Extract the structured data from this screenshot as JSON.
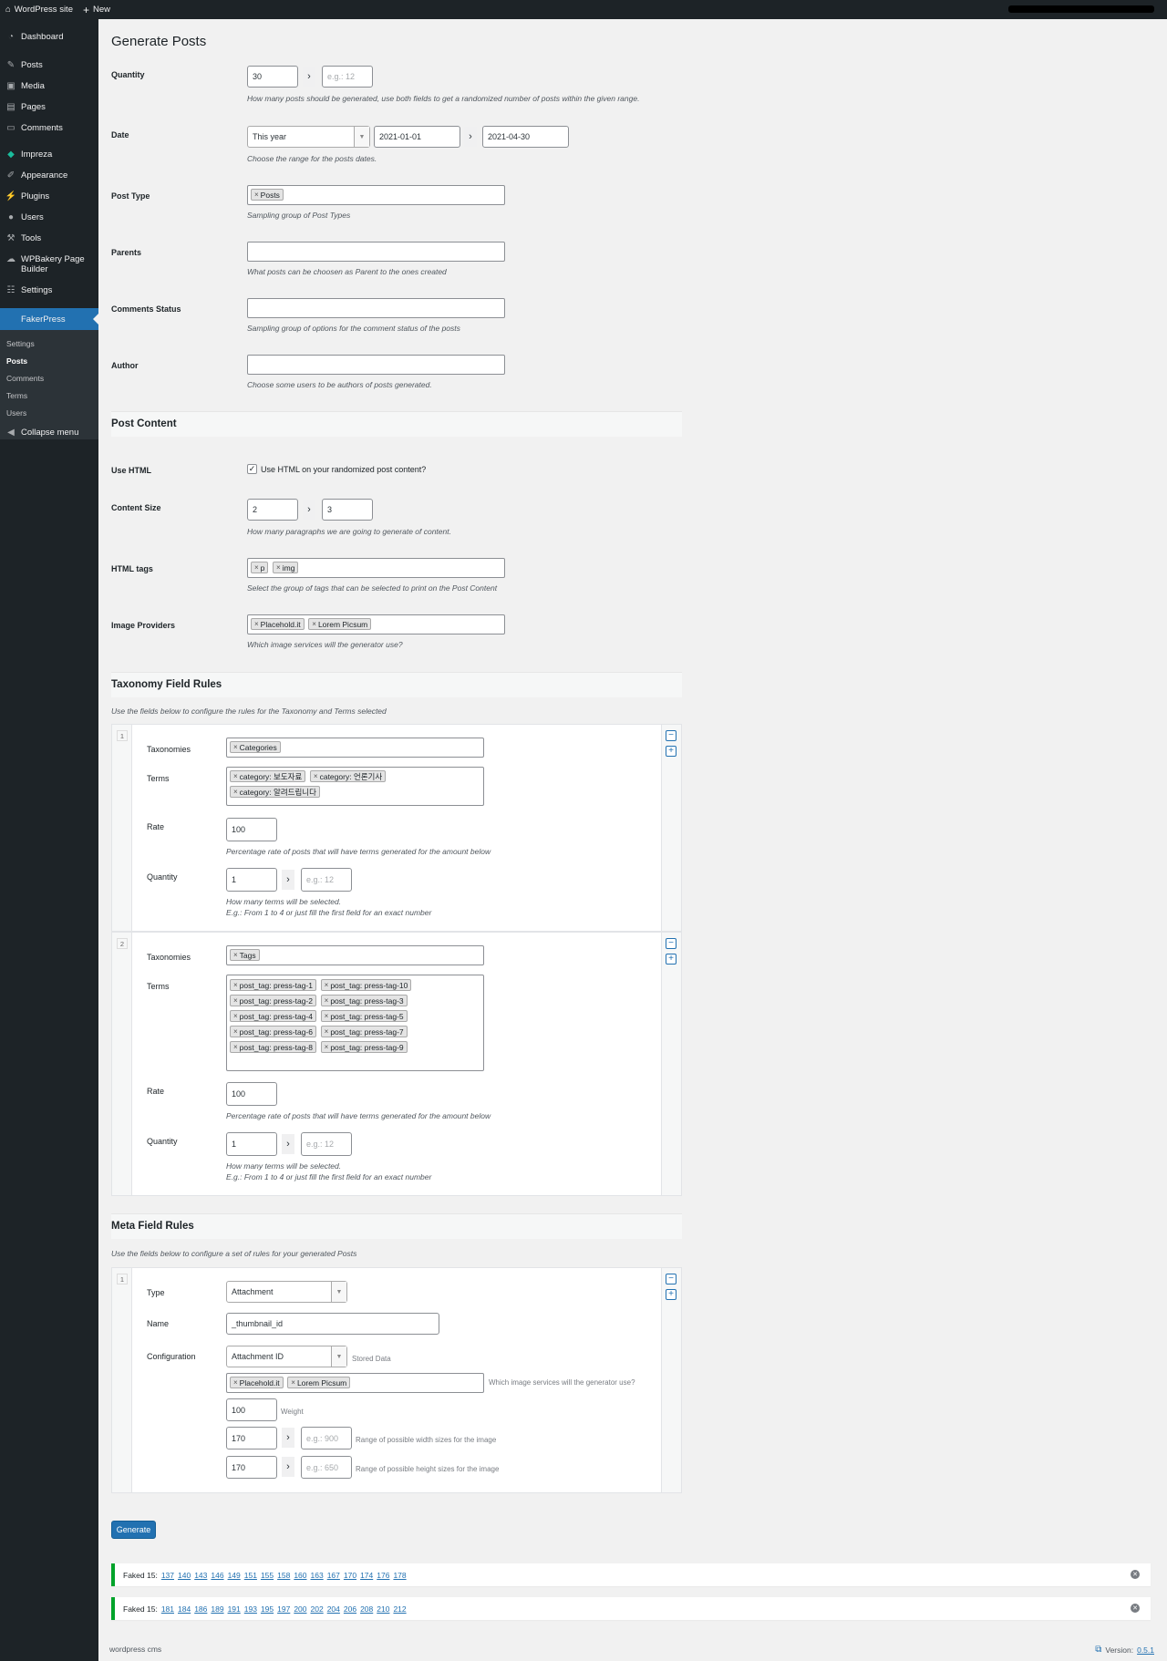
{
  "adminbar": {
    "site_name": "WordPress site",
    "new_label": "New"
  },
  "sidebar": {
    "items": [
      {
        "label": "Dashboard",
        "icon": "dashboard-icon"
      },
      {
        "label": "Posts",
        "icon": "pin-icon"
      },
      {
        "label": "Media",
        "icon": "media-icon"
      },
      {
        "label": "Pages",
        "icon": "pages-icon"
      },
      {
        "label": "Comments",
        "icon": "comments-icon"
      },
      {
        "label": "Impreza",
        "icon": "impreza-icon"
      },
      {
        "label": "Appearance",
        "icon": "brush-icon"
      },
      {
        "label": "Plugins",
        "icon": "plug-icon"
      },
      {
        "label": "Users",
        "icon": "user-icon"
      },
      {
        "label": "Tools",
        "icon": "wrench-icon"
      },
      {
        "label": "WPBakery Page Builder",
        "icon": "wpbakery-icon"
      },
      {
        "label": "Settings",
        "icon": "settings-icon"
      },
      {
        "label": "FakerPress",
        "icon": "fakerpress-icon"
      }
    ],
    "submenu": [
      "Settings",
      "Posts",
      "Comments",
      "Terms",
      "Users"
    ],
    "collapse_label": "Collapse menu"
  },
  "page": {
    "title": "Generate Posts"
  },
  "fields": {
    "quantity": {
      "label": "Quantity",
      "min": "30",
      "max_placeholder": "e.g.: 12",
      "desc": "How many posts should be generated, use both fields to get a randomized number of posts within the given range."
    },
    "date": {
      "label": "Date",
      "preset": "This year",
      "from": "2021-01-01",
      "to": "2021-04-30",
      "desc": "Choose the range for the posts dates."
    },
    "post_type": {
      "label": "Post Type",
      "chips": [
        "Posts"
      ],
      "desc": "Sampling group of Post Types"
    },
    "parents": {
      "label": "Parents",
      "desc": "What posts can be choosen as Parent to the ones created"
    },
    "comments_status": {
      "label": "Comments Status",
      "desc": "Sampling group of options for the comment status of the posts"
    },
    "author": {
      "label": "Author",
      "desc": "Choose some users to be authors of posts generated."
    }
  },
  "post_content": {
    "title": "Post Content",
    "use_html": {
      "label": "Use HTML",
      "checkbox_label": "Use HTML on your randomized post content?",
      "checked": true
    },
    "content_size": {
      "label": "Content Size",
      "min": "2",
      "max": "3",
      "desc": "How many paragraphs we are going to generate of content."
    },
    "html_tags": {
      "label": "HTML tags",
      "chips": [
        "p",
        "img"
      ],
      "desc": "Select the group of tags that can be selected to print on the Post Content"
    },
    "image_providers": {
      "label": "Image Providers",
      "chips": [
        "Placehold.it",
        "Lorem Picsum"
      ],
      "desc": "Which image services will the generator use?"
    }
  },
  "taxonomy": {
    "title": "Taxonomy Field Rules",
    "desc": "Use the fields below to configure the rules for the Taxonomy and Terms selected",
    "labels": {
      "taxonomies": "Taxonomies",
      "terms": "Terms",
      "rate": "Rate",
      "quantity": "Quantity"
    },
    "rate_desc": "Percentage rate of posts that will have terms generated for the amount below",
    "qty_desc1": "How many terms will be selected.",
    "qty_desc2": "E.g.: From 1 to 4 or just fill the first field for an exact number",
    "rules": [
      {
        "num": "1",
        "taxonomies": [
          "Categories"
        ],
        "terms": [
          "category: 보도자료",
          "category: 언론기사",
          "category: 알려드립니다"
        ],
        "rate": "100",
        "qty_min": "1",
        "qty_placeholder": "e.g.: 12"
      },
      {
        "num": "2",
        "taxonomies": [
          "Tags"
        ],
        "terms": [
          "post_tag: press-tag-1",
          "post_tag: press-tag-10",
          "post_tag: press-tag-2",
          "post_tag: press-tag-3",
          "post_tag: press-tag-4",
          "post_tag: press-tag-5",
          "post_tag: press-tag-6",
          "post_tag: press-tag-7",
          "post_tag: press-tag-8",
          "post_tag: press-tag-9"
        ],
        "rate": "100",
        "qty_min": "1",
        "qty_placeholder": "e.g.: 12"
      }
    ]
  },
  "meta": {
    "title": "Meta Field Rules",
    "desc": "Use the fields below to configure a set of rules for your generated Posts",
    "rule": {
      "num": "1",
      "type_label": "Type",
      "type_value": "Attachment",
      "name_label": "Name",
      "name_value": "_thumbnail_id",
      "config_label": "Configuration",
      "config_value": "Attachment ID",
      "stored_label": "Stored Data",
      "providers": [
        "Placehold.it",
        "Lorem Picsum"
      ],
      "providers_desc": "Which image services will the generator use?",
      "weight": "100",
      "weight_label": "Weight",
      "width_min": "170",
      "width_placeholder": "e.g.: 900",
      "width_desc": "Range of possible width sizes for the image",
      "height_min": "170",
      "height_placeholder": "e.g.: 650",
      "height_desc": "Range of possible height sizes for the image"
    }
  },
  "generate_label": "Generate",
  "notices": [
    {
      "prefix": "Faked 15:",
      "ids": [
        "137",
        "140",
        "143",
        "146",
        "149",
        "151",
        "155",
        "158",
        "160",
        "163",
        "167",
        "170",
        "174",
        "176",
        "178"
      ]
    },
    {
      "prefix": "Faked 15:",
      "ids": [
        "181",
        "184",
        "186",
        "189",
        "191",
        "193",
        "195",
        "197",
        "200",
        "202",
        "204",
        "206",
        "208",
        "210",
        "212"
      ]
    }
  ],
  "footer": {
    "left": "wordpress cms",
    "version_prefix": "Version:",
    "version": "0.5.1"
  },
  "colors": {
    "accent": "#2271b1",
    "sidebar_bg": "#1d2327",
    "success": "#00a32a"
  }
}
